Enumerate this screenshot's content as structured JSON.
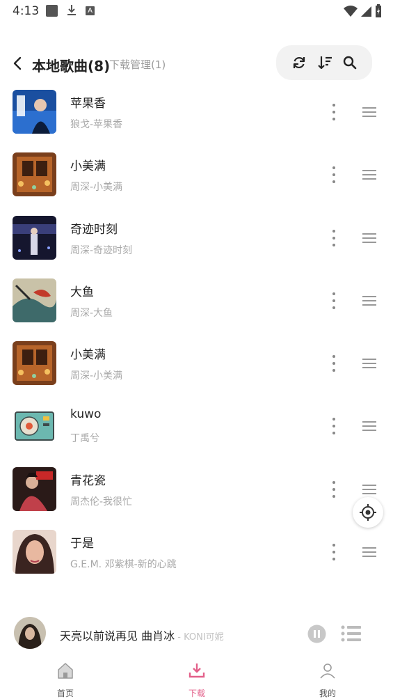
{
  "status_bar": {
    "time": "4:13",
    "icons": [
      "square-notification-icon",
      "download-icon",
      "a-notification-icon",
      "wifi-icon",
      "signal-icon",
      "battery-charging-icon"
    ]
  },
  "header": {
    "title": "本地歌曲(8)",
    "subtitle": "下载管理(1)",
    "actions": [
      "refresh-icon",
      "sort-icon",
      "search-icon"
    ]
  },
  "songs": [
    {
      "title": "苹果香",
      "artist": "狼戈-苹果香",
      "cover": "cover-1"
    },
    {
      "title": "小美满",
      "artist": "周深-小美满",
      "cover": "cover-2"
    },
    {
      "title": "奇迹时刻",
      "artist": "周深-奇迹时刻",
      "cover": "cover-3"
    },
    {
      "title": "大鱼",
      "artist": "周深-大鱼",
      "cover": "cover-4"
    },
    {
      "title": "小美满",
      "artist": "周深-小美满",
      "cover": "cover-5"
    },
    {
      "title": "kuwo",
      "artist": "丁禹兮",
      "cover": "cover-6"
    },
    {
      "title": "青花瓷",
      "artist": "周杰伦-我很忙",
      "cover": "cover-7"
    },
    {
      "title": "于是",
      "artist": "G.E.M. 邓紫棋-新的心跳",
      "cover": "cover-8"
    }
  ],
  "player": {
    "title": "天亮以前说再见 曲肖冰",
    "separator": " - ",
    "artist": "KONI可妮"
  },
  "tabs": [
    {
      "label": "首页",
      "icon": "home-icon",
      "active": false
    },
    {
      "label": "下载",
      "icon": "download-icon",
      "active": true
    },
    {
      "label": "我的",
      "icon": "profile-icon",
      "active": false
    }
  ],
  "colors": {
    "accent": "#e3608a",
    "secondary_text": "#a8a8a8",
    "toolbar_bg": "#f2f2f2"
  }
}
